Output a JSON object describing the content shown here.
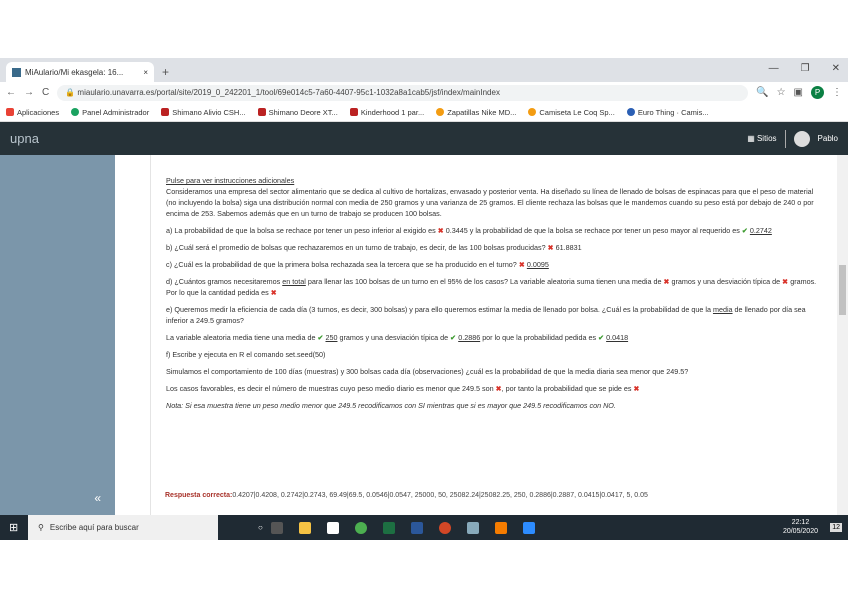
{
  "browser": {
    "tab_title": "MiAulario/Mi ekasgela: 16...",
    "url": "miaulario.unavarra.es/portal/site/2019_0_242201_1/tool/69e014c5-7a60-4407-95c1-1032a8a1cab5/jsf/index/mainIndex",
    "bookmarks": [
      "Aplicaciones",
      "Panel Administrador",
      "Shimano Alivio CSH...",
      "Shimano Deore XT...",
      "Kinderhood 1 par...",
      "Zapatillas Nike MD...",
      "Camiseta Le Coq Sp...",
      "Euro Thing · Camis..."
    ]
  },
  "header": {
    "logo": "upna",
    "sites": "Sitios",
    "user": "Pablo"
  },
  "question": {
    "instructions_link": "Pulse para ver instrucciones adicionales",
    "intro": "Consideramos una empresa del sector alimentario que se dedica al cultivo de hortalizas, envasado y posterior venta. Ha diseñado su línea de llenado de bolsas de espinacas para que el peso de material (no incluyendo la bolsa) siga una distribución normal con media de 250 gramos y una varianza de 25 gramos. El cliente rechaza las bolsas que le mandemos cuando su peso está por debajo de 240 o por encima de 253. Sabemos además que en un turno de trabajo se producen 100 bolsas.",
    "a_text": "a) La probabilidad de que la bolsa se rechace por tener un peso inferior al exigido es",
    "a_val1": "0.3445",
    "a_mid": "y la probabilidad de que la bolsa se rechace por tener un peso mayor al requerido es",
    "a_val2": "0.2742",
    "b_text": "b) ¿Cuál será el promedio de bolsas que rechazaremos en un turno de trabajo, es decir, de las 100 bolsas producidas?",
    "b_val": "61.8831",
    "c_text": "c) ¿Cuál es la probabilidad de que la primera bolsa rechazada sea la tercera que se ha producido en el turno?",
    "c_val": "0.0095",
    "d_text1": "d) ¿Cuántos gramos necesitaremos",
    "d_u": "en total",
    "d_text2": "para llenar las 100 bolsas de un turno en el 95% de los casos? La variable aleatoria suma tienen una media de",
    "d_text3": "gramos y una desviación típica de",
    "d_text4": "gramos. Por lo que la cantidad pedida es",
    "e_text1": "e) Queremos medir la eficiencia de cada día (3 turnos, es decir, 300 bolsas) y para ello queremos estimar la media de llenado por bolsa. ¿Cuál es la probabilidad de que la",
    "e_u": "media",
    "e_text2": "de llenado por día sea inferior a 249.5 gramos?",
    "e2_text1": "La variable aleatoria media tiene una media de",
    "e2_val1": "250",
    "e2_text2": "gramos y una desviación típica de",
    "e2_val2": "0.2886",
    "e2_text3": "por lo que la probabilidad pedida es",
    "e2_val3": "0.0418",
    "f_text": "f) Escribe y ejecuta en R el comando set.seed(50)",
    "sim_text": "Simulamos el comportamiento de 100 días (muestras) y 300 bolsas cada día (observaciones) ¿cuál es la probabilidad de que la media diaria sea menor que 249.5?",
    "fav_text1": "Los casos favorables, es decir el número de muestras cuyo peso medio diario es menor que 249.5 son",
    "fav_text2": ", por tanto la probabilidad que se pide es",
    "note": "Nota: Si esa muestra tiene un peso medio menor que 249.5 recodificamos con SI mientras que si es mayor que 249.5 recodificamos con NO.",
    "resp_label": "Respuesta correcta:",
    "resp_value": "0.4207|0.4208, 0.2742|0.2743, 69.49|69.5, 0.0546|0.0547, 25000, 50, 25082.24|25082.25, 250, 0.2886|0.2887, 0.0415|0.0417, 5, 0.05"
  },
  "taskbar": {
    "search": "Escribe aquí para buscar",
    "time": "22:12",
    "date": "20/05/2020",
    "notif": "12"
  }
}
